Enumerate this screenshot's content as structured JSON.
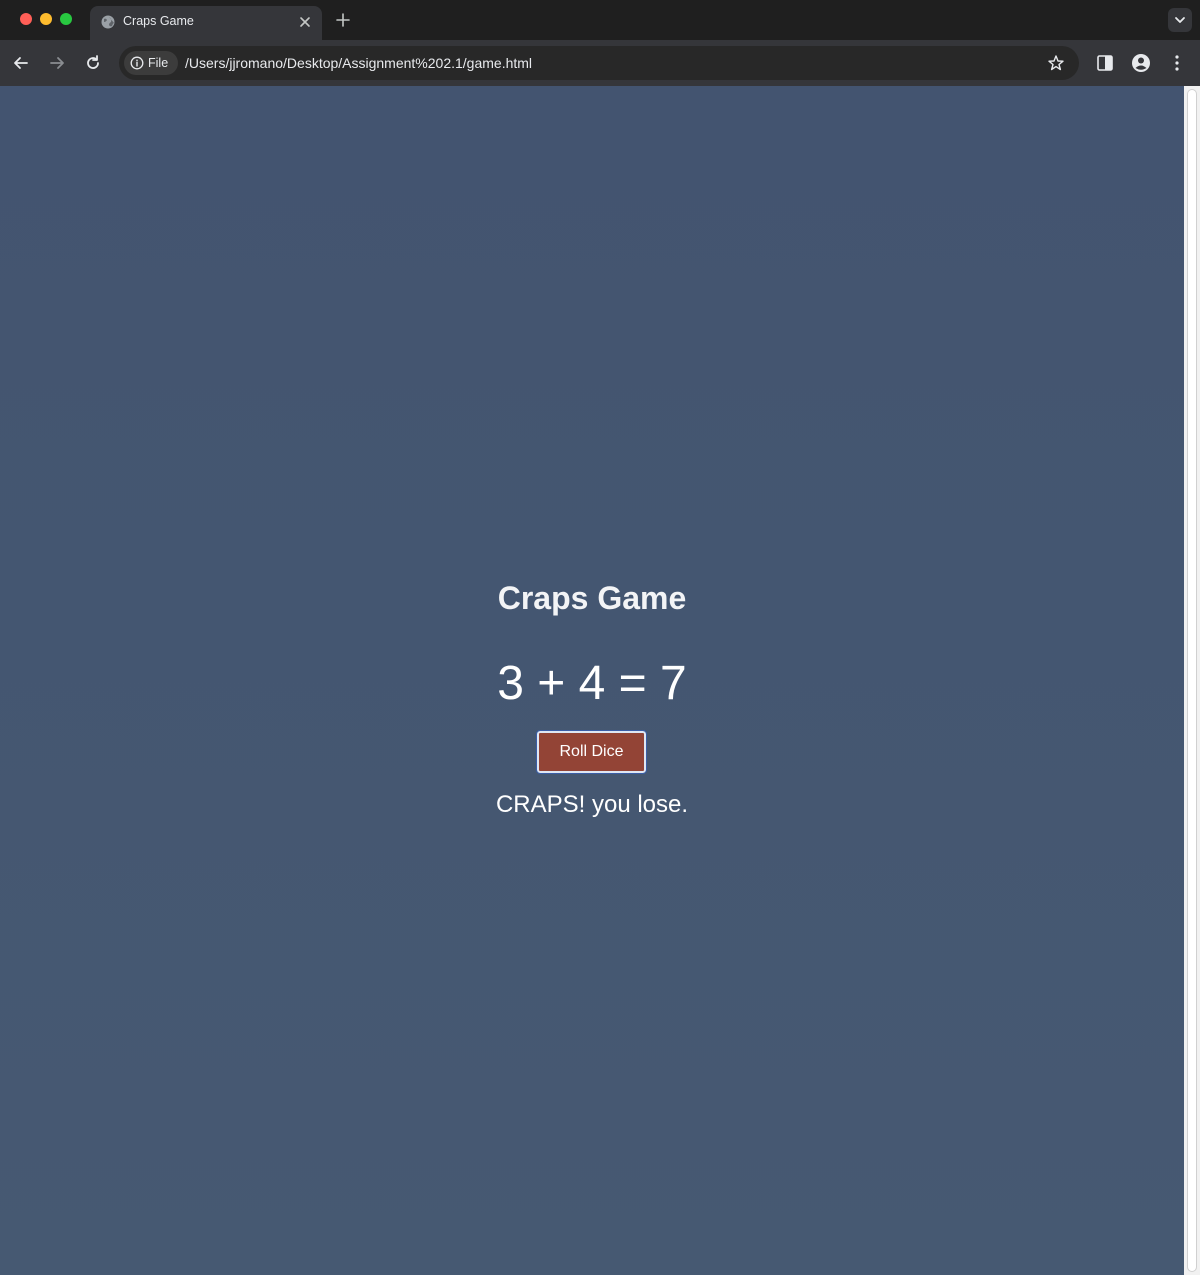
{
  "tab": {
    "title": "Craps Game"
  },
  "toolbar": {
    "chip_label": "File",
    "url": "/Users/jjromano/Desktop/Assignment%202.1/game.html"
  },
  "game": {
    "title": "Craps Game",
    "dice_result": "3 + 4 = 7",
    "roll_button_label": "Roll Dice",
    "result_message": "CRAPS! you lose."
  },
  "colors": {
    "page_background": "#445671",
    "button_background": "#934436"
  },
  "icons": [
    "globe-icon",
    "close-icon",
    "plus-icon",
    "chevron-down-icon",
    "back-arrow-icon",
    "forward-arrow-icon",
    "reload-icon",
    "info-icon",
    "star-icon",
    "side-panel-icon",
    "profile-icon",
    "more-vert-icon"
  ]
}
